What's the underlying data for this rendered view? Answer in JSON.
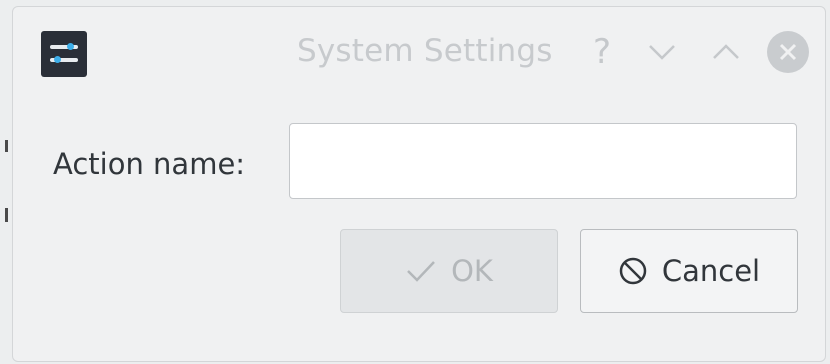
{
  "window": {
    "title": "System Settings",
    "help_glyph": "?",
    "icons": {
      "app": "system-settings-icon",
      "help": "help-icon",
      "minimize": "chevron-down-icon",
      "maximize": "chevron-up-icon",
      "close": "close-icon"
    }
  },
  "form": {
    "action_name_label": "Action name:",
    "action_name_value": "",
    "action_name_placeholder": ""
  },
  "buttons": {
    "ok_label": "OK",
    "ok_enabled": false,
    "cancel_label": "Cancel"
  },
  "colors": {
    "accent": "#3daee9",
    "text": "#31363b",
    "disabled_text": "#b3b7ba"
  }
}
